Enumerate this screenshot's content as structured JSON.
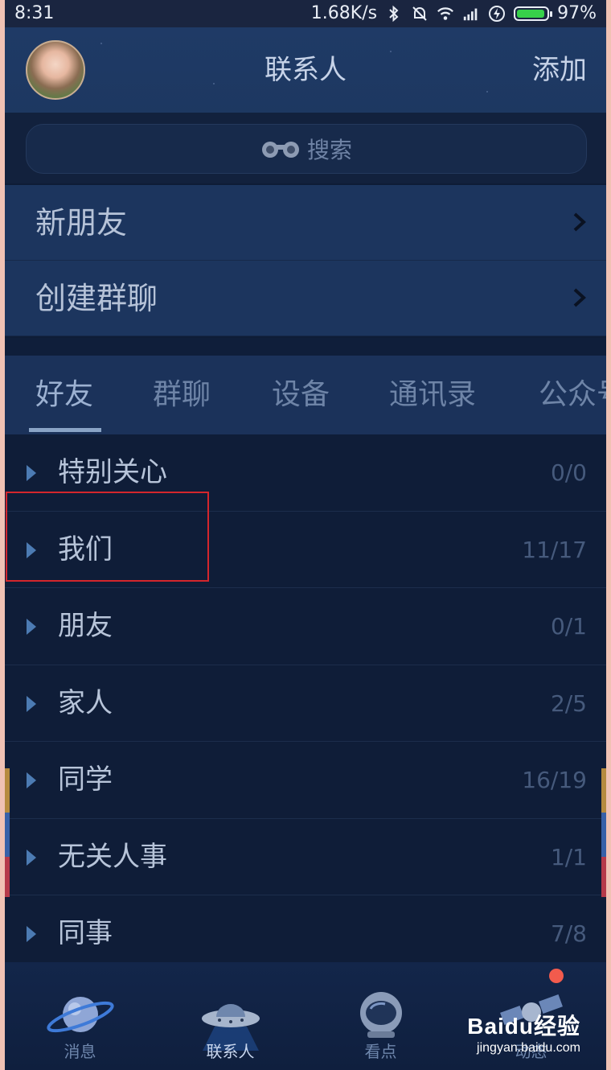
{
  "status_bar": {
    "time": "8:31",
    "network_speed": "1.68K/s",
    "battery": "97%"
  },
  "header": {
    "title": "联系人",
    "add_label": "添加"
  },
  "search": {
    "placeholder": "搜索"
  },
  "menu": {
    "new_friends": "新朋友",
    "create_group_chat": "创建群聊"
  },
  "tabs": [
    {
      "label": "好友",
      "active": true
    },
    {
      "label": "群聊"
    },
    {
      "label": "设备"
    },
    {
      "label": "通讯录"
    },
    {
      "label": "公众号"
    }
  ],
  "groups": [
    {
      "name": "特别关心",
      "count": "0/0"
    },
    {
      "name": "我们",
      "count": "11/17"
    },
    {
      "name": "朋友",
      "count": "0/1"
    },
    {
      "name": "家人",
      "count": "2/5"
    },
    {
      "name": "同学",
      "count": "16/19"
    },
    {
      "name": "无关人事",
      "count": "1/1"
    },
    {
      "name": "同事",
      "count": "7/8"
    }
  ],
  "bottom_nav": [
    {
      "label": "消息",
      "icon": "planet-icon"
    },
    {
      "label": "联系人",
      "icon": "ufo-icon",
      "active": true
    },
    {
      "label": "看点",
      "icon": "astronaut-helmet-icon"
    },
    {
      "label": "动态",
      "icon": "satellite-icon"
    }
  ],
  "watermark": {
    "brand": "Baidu经验",
    "url": "jingyan.baidu.com"
  },
  "colors": {
    "accent_underline": "#8aa4c6",
    "highlight_box": "#d4262c",
    "notification_dot": "#f25b4d",
    "battery_fill": "#37d14a"
  }
}
